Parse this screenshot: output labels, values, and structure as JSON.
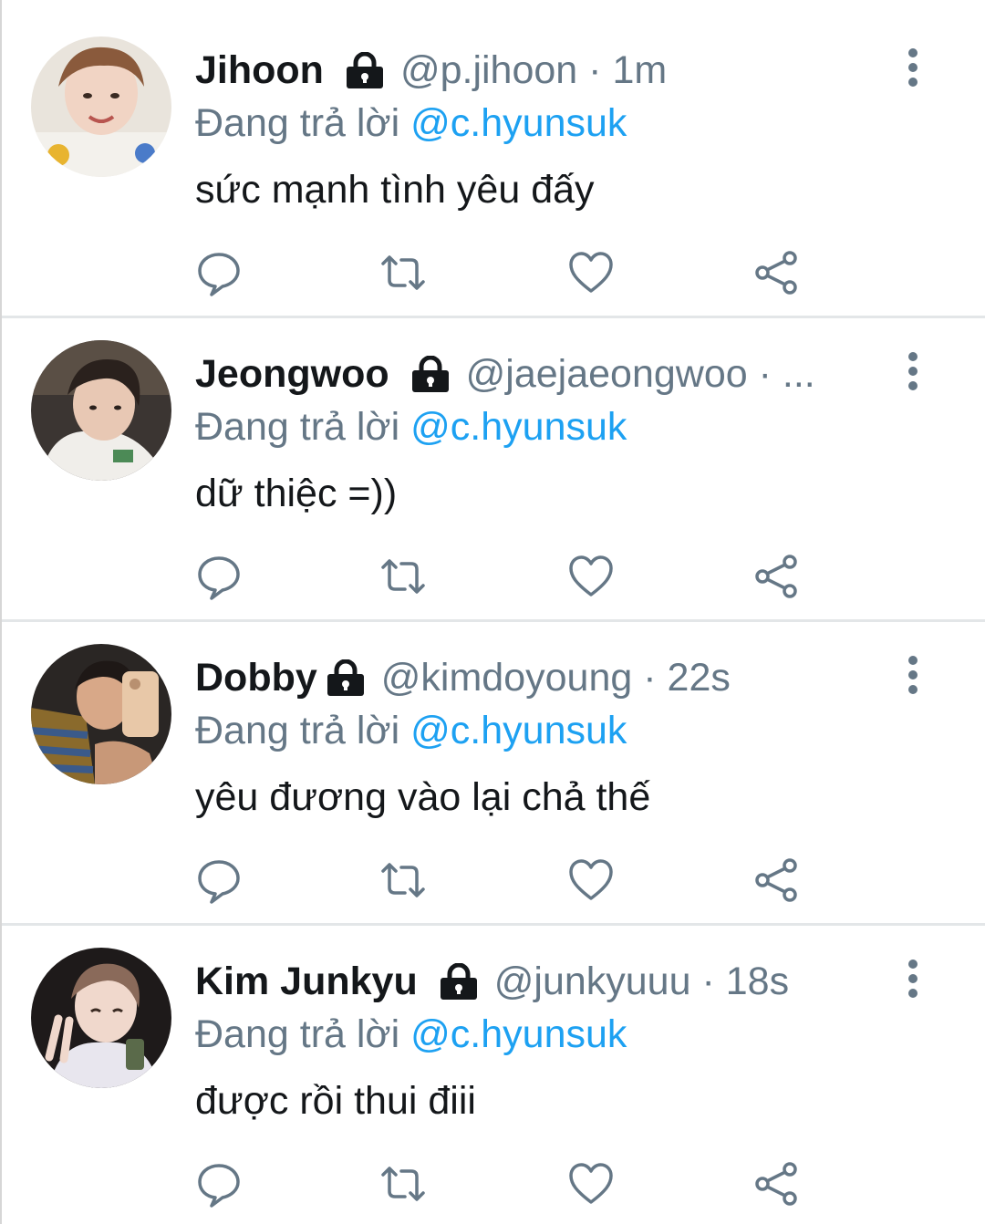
{
  "colors": {
    "name": "#14171a",
    "secondary": "#657786",
    "mention": "#1da1f2",
    "divider": "#e3e6e8",
    "icon": "#657786"
  },
  "tweets": [
    {
      "name": "Jihoon",
      "handle": "@p.jihoon",
      "separator": "·",
      "time": "1m",
      "replying_prefix": "Đang trả lời",
      "replying_to": "@c.hyunsuk",
      "text": "sức mạnh tình yêu đấy",
      "avatar_icon": "profile-photo"
    },
    {
      "name": "Jeongwoo",
      "handle": "@jaejaeongwoo",
      "separator": "·",
      "time": "...",
      "replying_prefix": "Đang trả lời",
      "replying_to": "@c.hyunsuk",
      "text": "dữ thiệc =))",
      "avatar_icon": "profile-photo"
    },
    {
      "name": "Dobby",
      "handle": "@kimdoyoung",
      "separator": "·",
      "time": "22s",
      "replying_prefix": "Đang trả lời",
      "replying_to": "@c.hyunsuk",
      "text": "yêu đương vào lại chả thế",
      "avatar_icon": "profile-photo"
    },
    {
      "name": "Kim Junkyu",
      "handle": "@junkyuuu",
      "separator": "·",
      "time": "18s",
      "replying_prefix": "Đang trả lời",
      "replying_to": "@c.hyunsuk",
      "text": "được rồi thui điii",
      "avatar_icon": "profile-photo"
    }
  ],
  "icons": {
    "lock": "lock-icon",
    "more": "more-vertical-icon",
    "reply": "reply-bubble-icon",
    "retweet": "retweet-icon",
    "like": "heart-icon",
    "share": "share-icon"
  }
}
